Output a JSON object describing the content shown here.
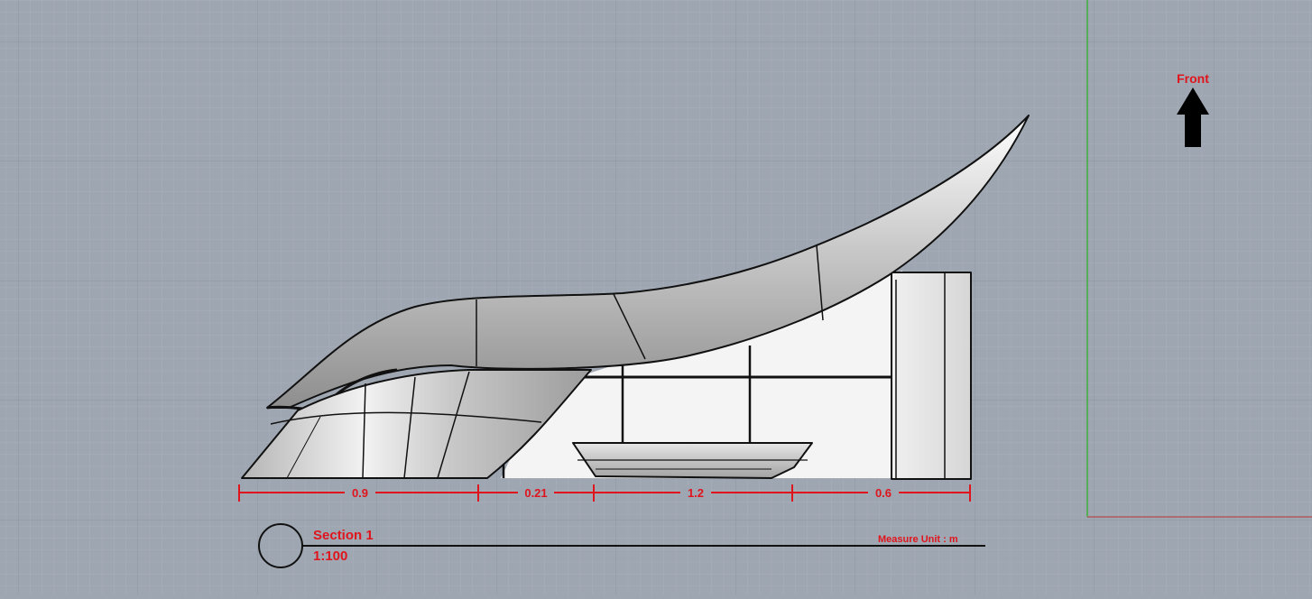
{
  "orientation": {
    "label": "Front"
  },
  "dimensions": [
    {
      "value": "0.9"
    },
    {
      "value": "0.21"
    },
    {
      "value": "1.2"
    },
    {
      "value": "0.6"
    }
  ],
  "section": {
    "title": "Section 1",
    "scale": "1:100"
  },
  "measure_unit": "Measure Unit : m",
  "colors": {
    "background": "#9ea6b1",
    "grid_minor": "#a8afb9",
    "grid_major": "#8f97a2",
    "annotation": "#e0141c",
    "axis_green": "#3fae3a",
    "axis_red": "#b05a5a"
  }
}
